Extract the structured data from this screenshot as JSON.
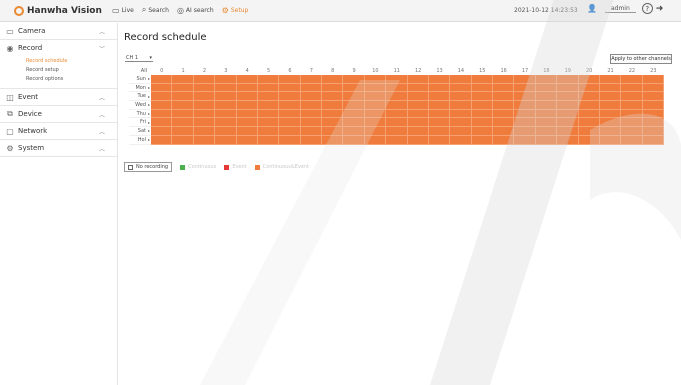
{
  "brand": {
    "name": "Hanwha Vision"
  },
  "topnav": [
    {
      "label": "Live",
      "icon": "monitor-icon",
      "active": false
    },
    {
      "label": "Search",
      "icon": "search-icon",
      "active": false
    },
    {
      "label": "AI search",
      "icon": "ai-search-icon",
      "active": false
    },
    {
      "label": "Setup",
      "icon": "gear-icon",
      "active": true
    }
  ],
  "datetime": "2021-10-12 14:23:53",
  "user": {
    "name": "admin",
    "help": "?"
  },
  "sidebar": [
    {
      "label": "Camera",
      "icon": "camera-icon",
      "expanded": false
    },
    {
      "label": "Record",
      "icon": "record-icon",
      "expanded": true,
      "items": [
        {
          "label": "Record schedule",
          "active": true
        },
        {
          "label": "Record setup",
          "active": false
        },
        {
          "label": "Record options",
          "active": false
        }
      ]
    },
    {
      "label": "Event",
      "icon": "event-icon",
      "expanded": false
    },
    {
      "label": "Device",
      "icon": "device-icon",
      "expanded": false
    },
    {
      "label": "Network",
      "icon": "network-icon",
      "expanded": false
    },
    {
      "label": "System",
      "icon": "system-icon",
      "expanded": false
    }
  ],
  "page": {
    "title": "Record schedule",
    "channel": "CH 1",
    "apply_label": "Apply to other channels"
  },
  "schedule": {
    "corner": "All",
    "hours": [
      "0",
      "1",
      "2",
      "3",
      "4",
      "5",
      "6",
      "7",
      "8",
      "9",
      "10",
      "11",
      "12",
      "13",
      "14",
      "15",
      "16",
      "17",
      "18",
      "19",
      "20",
      "21",
      "22",
      "23"
    ],
    "days": [
      "Sun",
      "Mon",
      "Tue",
      "Wed",
      "Thu",
      "Fri",
      "Sat",
      "Hol"
    ],
    "fill_color": "#ef7c3c",
    "all_cells_mode": "Continuous"
  },
  "legend": [
    {
      "label": "No recording",
      "color": "#ffffff",
      "selected": true
    },
    {
      "label": "Continuous",
      "color": "#4caf50",
      "selected": false
    },
    {
      "label": "Event",
      "color": "#e53935",
      "selected": false
    },
    {
      "label": "Continuous&Event",
      "color": "#ef7c3c",
      "selected": false
    }
  ],
  "colors": {
    "accent": "#e98a33",
    "grid_fill": "#ef7c3c"
  }
}
